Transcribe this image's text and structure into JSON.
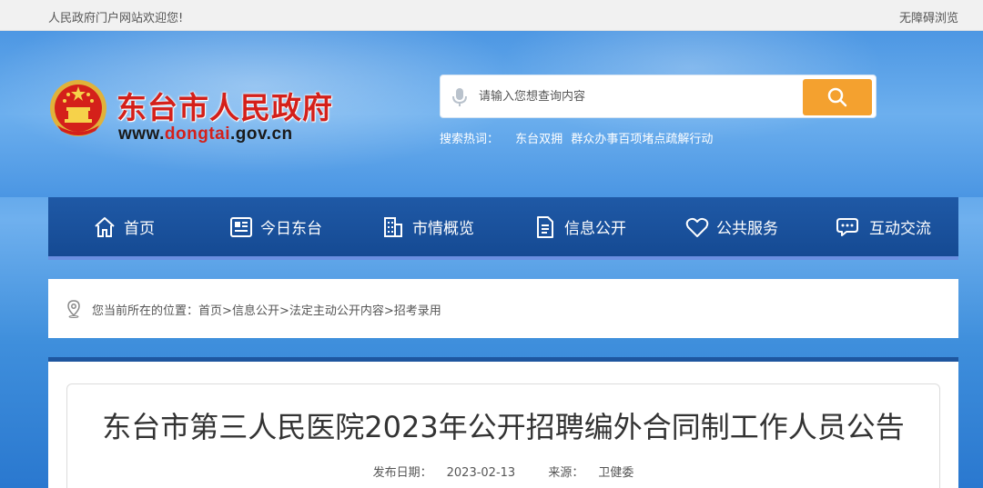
{
  "topbar": {
    "welcome": "人民政府门户网站欢迎您!",
    "accessibility": "无障碍浏览"
  },
  "header": {
    "site_title": "东台市人民政府",
    "url_prefix": "www.",
    "url_accent": "dongtai",
    "url_suffix": ".gov.cn",
    "emblem_icon": "national-emblem-icon"
  },
  "search": {
    "placeholder": "请输入您想查询内容",
    "value": "",
    "hot_label": "搜索热词：",
    "hot_words": [
      "东台双拥",
      "群众办事百项堵点疏解行动"
    ]
  },
  "nav": {
    "items": [
      {
        "label": "首页",
        "icon": "home-icon"
      },
      {
        "label": "今日东台",
        "icon": "newspaper-icon"
      },
      {
        "label": "市情概览",
        "icon": "building-icon"
      },
      {
        "label": "信息公开",
        "icon": "document-icon"
      },
      {
        "label": "公共服务",
        "icon": "heart-icon"
      },
      {
        "label": "互动交流",
        "icon": "chat-icon"
      }
    ]
  },
  "breadcrumb": {
    "prefix": "您当前所在的位置：",
    "items": [
      "首页",
      "信息公开",
      "法定主动公开内容",
      "招考录用"
    ],
    "separator": ">"
  },
  "article": {
    "title": "东台市第三人民医院2023年公开招聘编外合同制工作人员公告",
    "date_label": "发布日期：",
    "date": "2023-02-13",
    "source_label": "来源：",
    "source": "卫健委"
  },
  "colors": {
    "brand_red": "#d4201a",
    "nav_blue": "#1a52a0",
    "search_orange": "#f4a12f"
  }
}
